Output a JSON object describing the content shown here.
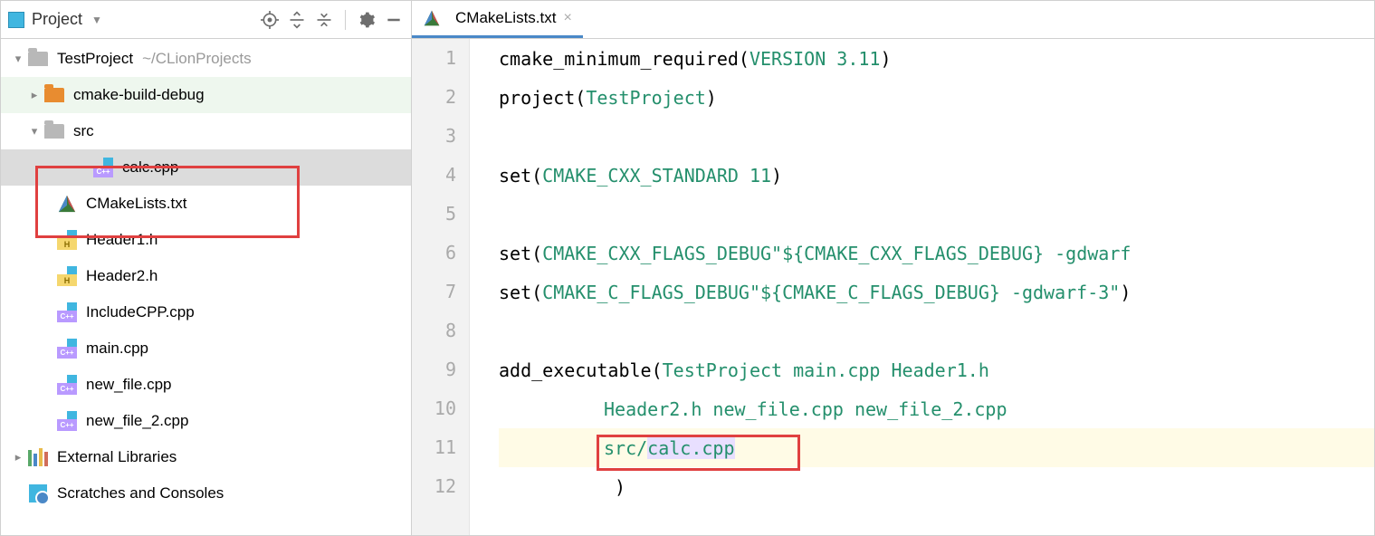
{
  "sidebar": {
    "title": "Project",
    "root": {
      "name": "TestProject",
      "path": "~/CLionProjects"
    },
    "nodes": {
      "build_dir": "cmake-build-debug",
      "src_dir": "src",
      "calc": "calc.cpp",
      "cmakelists": "CMakeLists.txt",
      "header1": "Header1.h",
      "header2": "Header2.h",
      "includecpp": "IncludeCPP.cpp",
      "main": "main.cpp",
      "newfile": "new_file.cpp",
      "newfile2": "new_file_2.cpp",
      "external": "External Libraries",
      "scratches": "Scratches and Consoles"
    }
  },
  "tab": {
    "label": "CMakeLists.txt"
  },
  "code": {
    "l1": {
      "fn": "cmake_minimum_required",
      "arg": "VERSION 3.11"
    },
    "l2": {
      "fn": "project",
      "arg": "TestProject"
    },
    "l4": {
      "fn": "set",
      "arg": "CMAKE_CXX_STANDARD 11"
    },
    "l6": {
      "fn": "set",
      "a1": "CMAKE_CXX_FLAGS_DEBUG ",
      "a2": "\"${CMAKE_CXX_FLAGS_DEBUG} -gdwarf"
    },
    "l7": {
      "fn": "set",
      "a1": "CMAKE_C_FLAGS_DEBUG ",
      "a2": "\"${CMAKE_C_FLAGS_DEBUG} -gdwarf-3\"",
      "close": ")"
    },
    "l9": {
      "fn": "add_executable",
      "args": "TestProject main.cpp Header1.h"
    },
    "l10": {
      "args": "Header2.h new_file.cpp new_file_2.cpp"
    },
    "l11": {
      "p1": "src/",
      "p2": "calc.cpp"
    },
    "l12": {
      "close": ")"
    }
  },
  "gutter": [
    "1",
    "2",
    "3",
    "4",
    "5",
    "6",
    "7",
    "8",
    "9",
    "10",
    "11",
    "12"
  ]
}
